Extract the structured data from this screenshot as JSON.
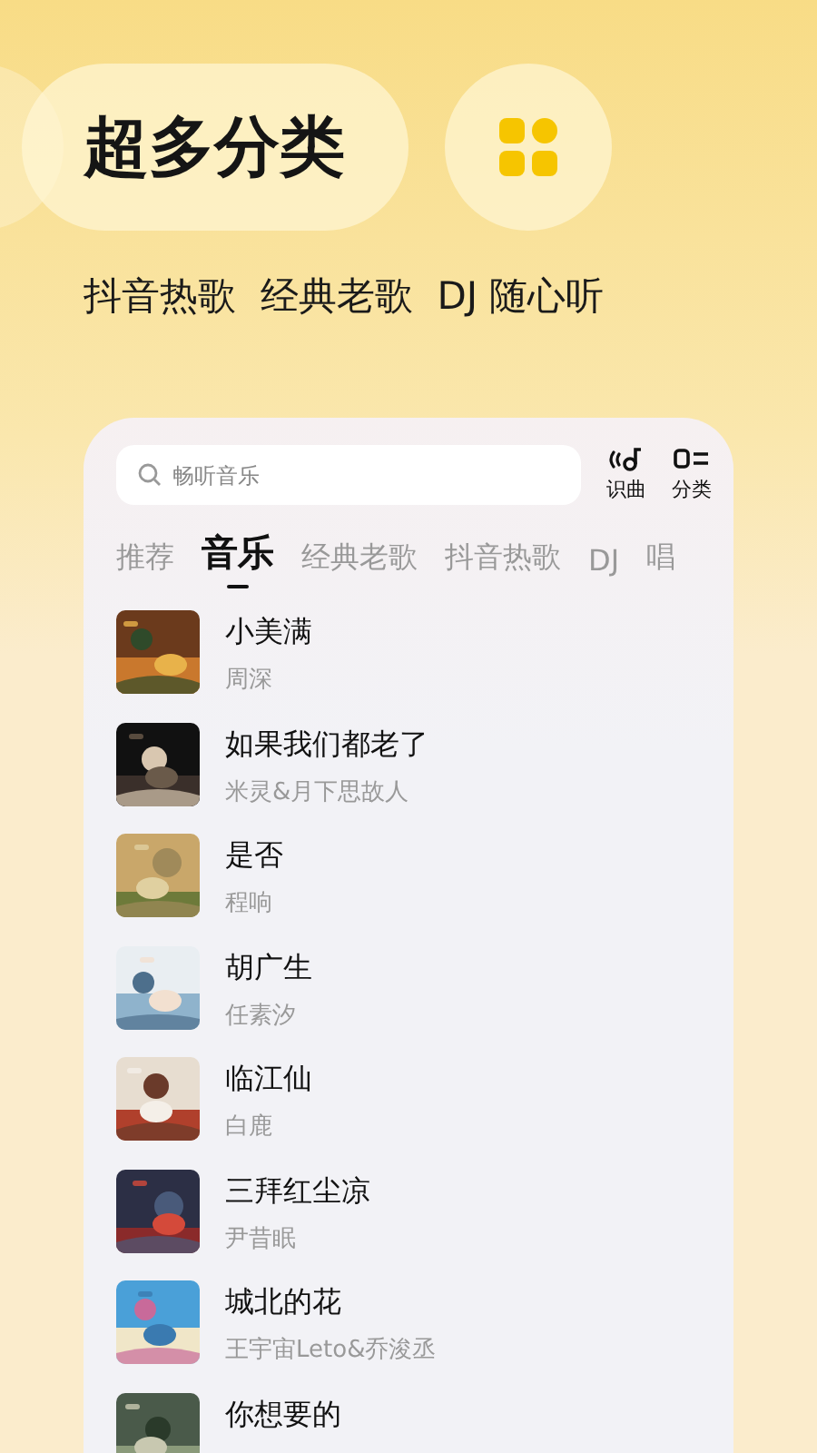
{
  "headline": "超多分类",
  "subtitle": "抖音热歌  经典老歌  DJ 随心听",
  "search": {
    "placeholder": "畅听音乐"
  },
  "actions": [
    {
      "kind": "recognize",
      "label": "识曲"
    },
    {
      "kind": "category",
      "label": "分类"
    }
  ],
  "tabs": [
    {
      "label": "推荐",
      "selected": false
    },
    {
      "label": "音乐",
      "selected": true
    },
    {
      "label": "经典老歌",
      "selected": false
    },
    {
      "label": "抖音热歌",
      "selected": false
    },
    {
      "label": "DJ",
      "selected": false
    },
    {
      "label": "唱",
      "selected": false
    }
  ],
  "songs": [
    {
      "title": "小美满",
      "artist": "周深"
    },
    {
      "title": "如果我们都老了",
      "artist": "米灵&月下思故人"
    },
    {
      "title": "是否",
      "artist": "程响"
    },
    {
      "title": "胡广生",
      "artist": "任素汐"
    },
    {
      "title": "临江仙",
      "artist": "白鹿"
    },
    {
      "title": "三拜红尘凉",
      "artist": "尹昔眠"
    },
    {
      "title": "城北的花",
      "artist": "王宇宙Leto&乔浚丞"
    },
    {
      "title": "你想要的"
    }
  ]
}
